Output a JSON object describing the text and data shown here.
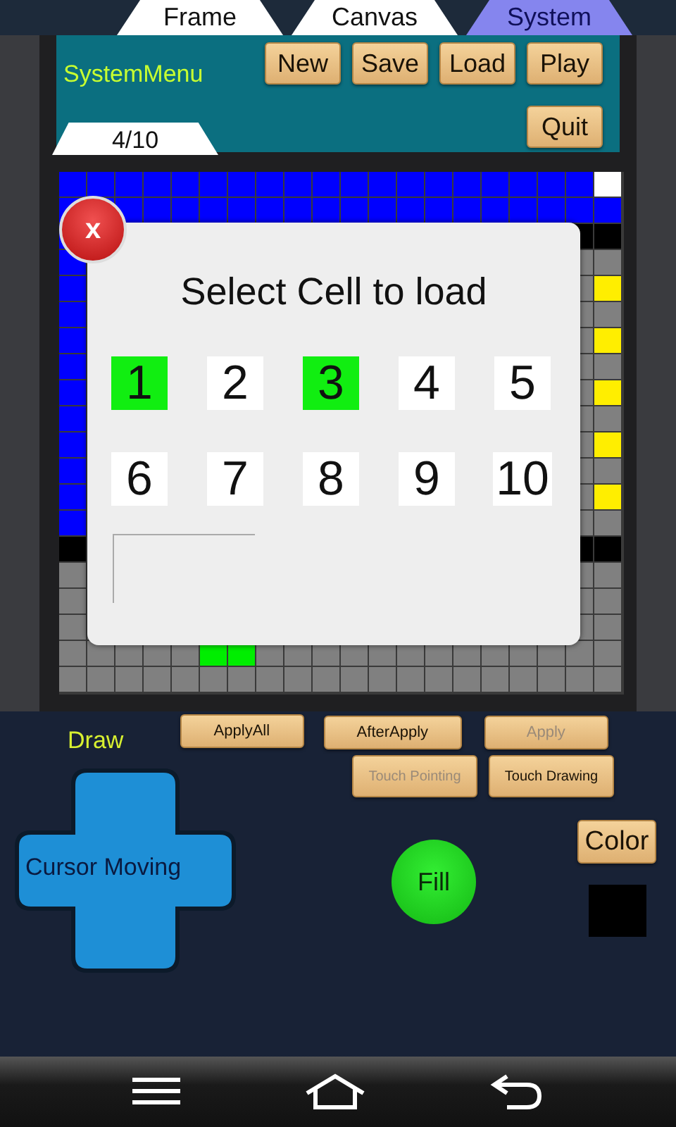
{
  "tabs": [
    {
      "label": "Frame",
      "selected": false
    },
    {
      "label": "Canvas",
      "selected": false
    },
    {
      "label": "System",
      "selected": true
    }
  ],
  "system_menu": {
    "title": "SystemMenu",
    "buttons": [
      {
        "label": "New"
      },
      {
        "label": "Save"
      },
      {
        "label": "Load"
      },
      {
        "label": "Play"
      },
      {
        "label": "Quit"
      }
    ]
  },
  "frame_counter": "4/10",
  "dialog": {
    "close": "x",
    "title": "Select Cell to load",
    "slots": [
      {
        "label": "1",
        "saved": true
      },
      {
        "label": "2",
        "saved": false
      },
      {
        "label": "3",
        "saved": true
      },
      {
        "label": "4",
        "saved": false
      },
      {
        "label": "5",
        "saved": false
      },
      {
        "label": "6",
        "saved": false
      },
      {
        "label": "7",
        "saved": false
      },
      {
        "label": "8",
        "saved": false
      },
      {
        "label": "9",
        "saved": false
      },
      {
        "label": "10",
        "saved": false
      }
    ]
  },
  "draw_panel": {
    "title": "Draw",
    "apply_buttons": [
      {
        "label": "ApplyAll",
        "disabled": false
      },
      {
        "label": "AfterApply",
        "disabled": false
      },
      {
        "label": "Apply",
        "disabled": true
      }
    ],
    "touch_buttons": [
      {
        "label": "Touch Pointing",
        "disabled": true
      },
      {
        "label": "Touch Drawing",
        "disabled": false
      }
    ],
    "dpad": "Cursor Moving",
    "fill": "Fill",
    "color_button": "Color"
  }
}
